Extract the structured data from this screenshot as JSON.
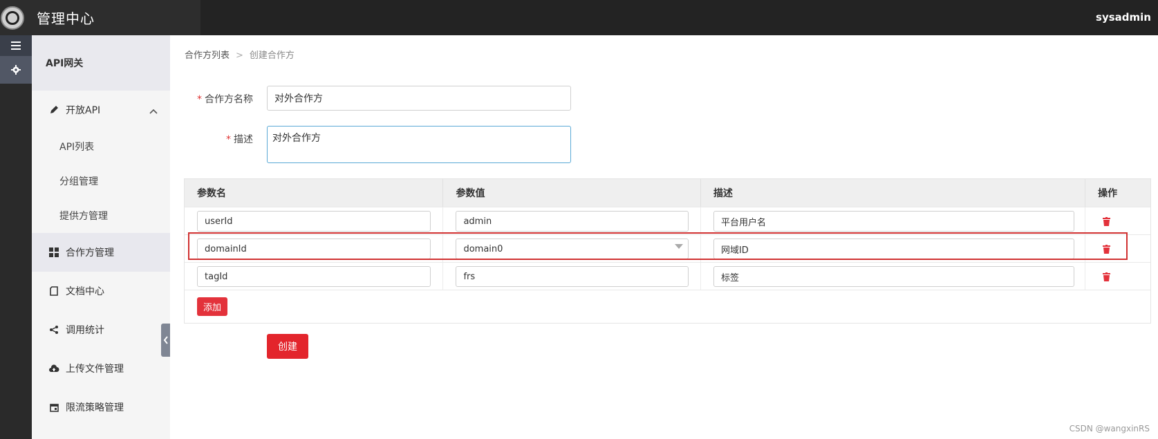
{
  "app": {
    "title": "管理中心",
    "user": "sysadmin"
  },
  "sidebar": {
    "header": "API网关",
    "items": [
      {
        "label": "开放API",
        "icon": "pencil-icon",
        "expanded": true,
        "children": [
          "API列表",
          "分组管理",
          "提供方管理"
        ]
      },
      {
        "label": "合作方管理",
        "icon": "grid-icon",
        "selected": true
      },
      {
        "label": "文档中心",
        "icon": "document-icon"
      },
      {
        "label": "调用统计",
        "icon": "share-icon"
      },
      {
        "label": "上传文件管理",
        "icon": "cloud-upload-icon"
      },
      {
        "label": "限流策略管理",
        "icon": "calendar-icon"
      }
    ]
  },
  "breadcrumb": {
    "parent": "合作方列表",
    "separator": ">",
    "current": "创建合作方"
  },
  "form": {
    "name_label": "合作方名称",
    "name_value": "对外合作方",
    "desc_label": "描述",
    "desc_value": "对外合作方",
    "required_mark": "*"
  },
  "params_table": {
    "headers": [
      "参数名",
      "参数值",
      "描述",
      "操作"
    ],
    "rows": [
      {
        "name": "userId",
        "value": "admin",
        "desc": "平台用户名"
      },
      {
        "name": "domainId",
        "value": "domain0",
        "desc": "网域ID",
        "value_is_select": true
      },
      {
        "name": "tagId",
        "value": "frs",
        "desc": "标签"
      }
    ],
    "add_label": "添加"
  },
  "create_label": "创建",
  "watermark": "CSDN @wangxinRS",
  "colors": {
    "accent_red": "#e3252c",
    "topbar": "#232323",
    "sidebar_bg": "#f5f5f5"
  }
}
